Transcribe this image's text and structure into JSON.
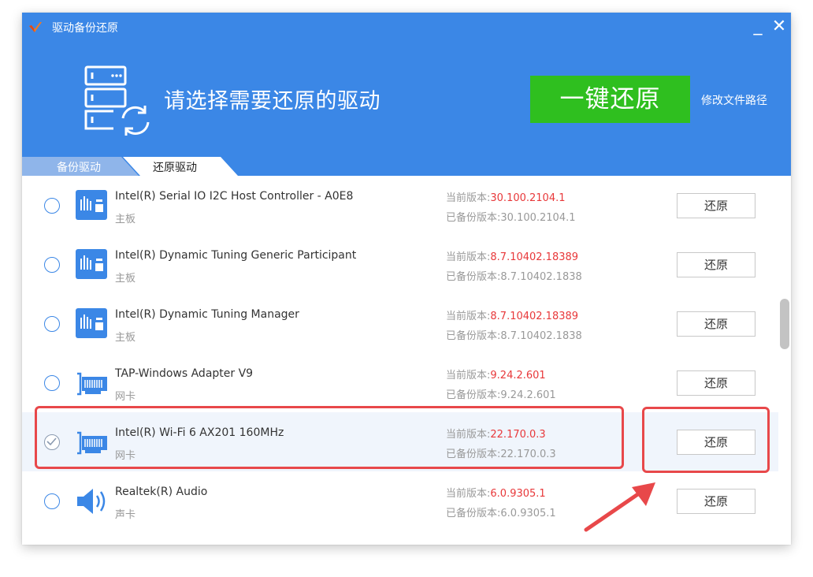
{
  "window": {
    "title": "驱动备份还原",
    "min_glyph": "_",
    "close_glyph": "✕"
  },
  "header": {
    "headline": "请选择需要还原的驱动",
    "one_click_label": "一键还原",
    "modify_path_label": "修改文件路径"
  },
  "tabs": [
    {
      "label": "备份驱动",
      "active": false
    },
    {
      "label": "还原驱动",
      "active": true
    }
  ],
  "drivers": [
    {
      "name": "Intel(R) Serial IO I2C Host Controller - A0E8",
      "type": "主板",
      "current_label": "当前版本:",
      "current_version": "30.100.2104.1",
      "backup_label": "已备份版本:",
      "backup_version": "30.100.2104.1",
      "button": "还原",
      "icon": "motherboard-icon",
      "selected": false
    },
    {
      "name": "Intel(R) Dynamic Tuning Generic Participant",
      "type": "主板",
      "current_label": "当前版本:",
      "current_version": "8.7.10402.18389",
      "backup_label": "已备份版本:",
      "backup_version": "8.7.10402.1838",
      "button": "还原",
      "icon": "motherboard-icon",
      "selected": false
    },
    {
      "name": "Intel(R) Dynamic Tuning Manager",
      "type": "主板",
      "current_label": "当前版本:",
      "current_version": "8.7.10402.18389",
      "backup_label": "已备份版本:",
      "backup_version": "8.7.10402.1838",
      "button": "还原",
      "icon": "motherboard-icon",
      "selected": false
    },
    {
      "name": "TAP-Windows Adapter V9",
      "type": "网卡",
      "current_label": "当前版本:",
      "current_version": "9.24.2.601",
      "backup_label": "已备份版本:",
      "backup_version": "9.24.2.601",
      "button": "还原",
      "icon": "network-card-icon",
      "selected": false
    },
    {
      "name": "Intel(R) Wi-Fi 6 AX201 160MHz",
      "type": "网卡",
      "current_label": "当前版本:",
      "current_version": "22.170.0.3",
      "backup_label": "已备份版本:",
      "backup_version": "22.170.0.3",
      "button": "还原",
      "icon": "network-card-icon",
      "selected": true
    },
    {
      "name": "Realtek(R) Audio",
      "type": "声卡",
      "current_label": "当前版本:",
      "current_version": "6.0.9305.1",
      "backup_label": "已备份版本:",
      "backup_version": "6.0.9305.1",
      "button": "还原",
      "icon": "speaker-icon",
      "selected": false
    }
  ],
  "colors": {
    "header_blue": "#3b87e6",
    "green_button": "#2fbf1f",
    "version_red": "#e8383a",
    "highlight_red": "#e8484a"
  }
}
